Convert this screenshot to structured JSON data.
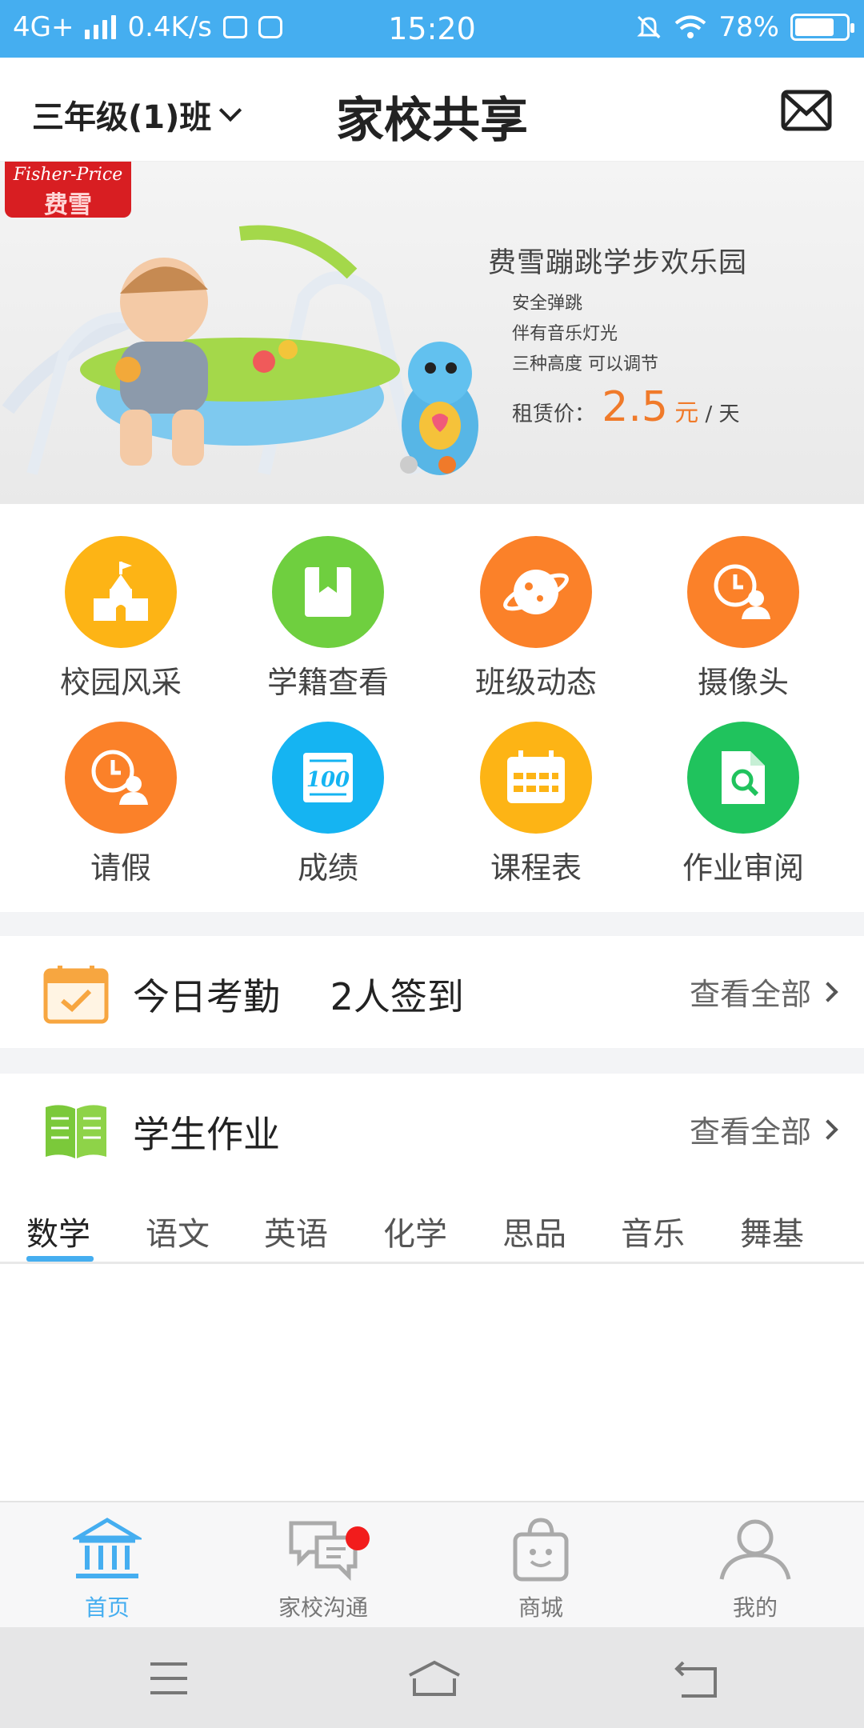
{
  "status_bar": {
    "network": "4G+",
    "speed": "0.4K/s",
    "time": "15:20",
    "battery": "78%",
    "battery_level": 0.78
  },
  "header": {
    "class_selector": "三年级(1)班",
    "title": "家校共享"
  },
  "banner": {
    "brand_line1": "Fisher-Price",
    "brand_line2": "费雪",
    "promo_title": "费雪蹦跳学步欢乐园",
    "features": [
      "安全弹跳",
      "伴有音乐灯光",
      "三种高度 可以调节"
    ],
    "price_label": "租赁价：",
    "price_value": "2.5",
    "price_unit": "元",
    "price_period": "/ 天",
    "slide_count": 2,
    "active_slide": 2
  },
  "features_grid": [
    {
      "label": "校园风采",
      "icon": "school-building-icon",
      "color": "#fdb415"
    },
    {
      "label": "学籍查看",
      "icon": "bookmark-icon",
      "color": "#6fcf3f"
    },
    {
      "label": "班级动态",
      "icon": "planet-icon",
      "color": "#fb8129"
    },
    {
      "label": "摄像头",
      "icon": "clock-person-icon",
      "color": "#fb8129"
    },
    {
      "label": "请假",
      "icon": "clock-person-icon",
      "color": "#fb8129"
    },
    {
      "label": "成绩",
      "icon": "score-100-icon",
      "color": "#15b4f2"
    },
    {
      "label": "课程表",
      "icon": "calendar-icon",
      "color": "#fdb415"
    },
    {
      "label": "作业审阅",
      "icon": "document-search-icon",
      "color": "#20c35d"
    }
  ],
  "attendance": {
    "title": "今日考勤",
    "summary": "2人签到",
    "view_all": "查看全部"
  },
  "homework": {
    "title": "学生作业",
    "view_all": "查看全部",
    "tabs": [
      "数学",
      "语文",
      "英语",
      "化学",
      "思品",
      "音乐",
      "舞基"
    ],
    "active_tab": 0
  },
  "bottom_nav": [
    {
      "label": "首页",
      "icon": "bank-icon",
      "active": true
    },
    {
      "label": "家校沟通",
      "icon": "chat-icon",
      "active": false,
      "badge": true
    },
    {
      "label": "商城",
      "icon": "shopping-bag-icon",
      "active": false
    },
    {
      "label": "我的",
      "icon": "person-icon",
      "active": false
    }
  ],
  "colors": {
    "accent": "#45aef0",
    "price": "#f07a2a",
    "badge": "#f21c1c"
  }
}
